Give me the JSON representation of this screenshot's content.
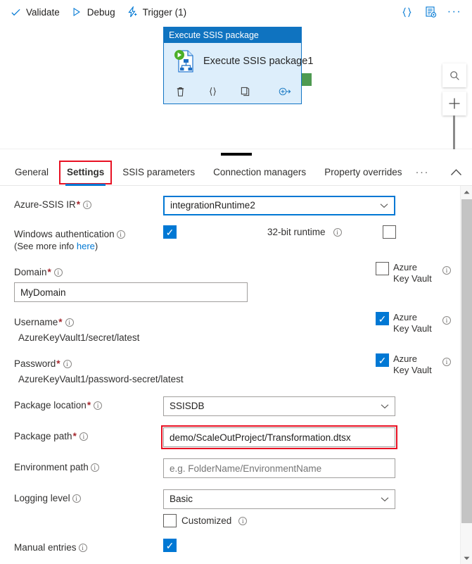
{
  "toolbar": {
    "validate_label": "Validate",
    "debug_label": "Debug",
    "trigger_label": "Trigger (1)",
    "code_icon_label": "{}",
    "dots_label": "···"
  },
  "canvas": {
    "activity": {
      "header": "Execute SSIS package",
      "title": "Execute SSIS package1"
    }
  },
  "tabs": {
    "items": [
      {
        "label": "General",
        "active": false,
        "marked": false
      },
      {
        "label": "Settings",
        "active": true,
        "marked": true
      },
      {
        "label": "SSIS parameters",
        "active": false,
        "marked": false
      },
      {
        "label": "Connection managers",
        "active": false,
        "marked": false
      },
      {
        "label": "Property overrides",
        "active": false,
        "marked": false
      }
    ],
    "overflow_label": "···"
  },
  "settings": {
    "azure_ssis_ir": {
      "label": "Azure-SSIS IR",
      "required": "*",
      "value": "integrationRuntime2"
    },
    "windows_auth": {
      "label": "Windows authentication",
      "sub_prefix": "(See more info ",
      "sub_link": "here",
      "sub_suffix": ")",
      "checked_mark": "✓"
    },
    "runtime_32bit": {
      "label": "32-bit runtime"
    },
    "domain": {
      "label": "Domain",
      "required": "*",
      "value": "MyDomain",
      "akv_label": "Azure Key Vault"
    },
    "username": {
      "label": "Username",
      "required": "*",
      "value": "AzureKeyVault1/secret/latest",
      "akv_label": "Azure Key Vault"
    },
    "password": {
      "label": "Password",
      "required": "*",
      "value": "AzureKeyVault1/password-secret/latest",
      "akv_label": "Azure Key Vault"
    },
    "package_location": {
      "label": "Package location",
      "required": "*",
      "value": "SSISDB"
    },
    "package_path": {
      "label": "Package path",
      "required": "*",
      "value": "demo/ScaleOutProject/Transformation.dtsx"
    },
    "environment_path": {
      "label": "Environment path",
      "placeholder": "e.g. FolderName/EnvironmentName",
      "value": ""
    },
    "logging_level": {
      "label": "Logging level",
      "value": "Basic",
      "customized_label": "Customized"
    },
    "manual_entries": {
      "label": "Manual entries"
    }
  },
  "colors": {
    "accent": "#0078d4",
    "activity_header": "#0f73c0",
    "activity_body": "#ddeefb",
    "highlight_red": "#e81123",
    "required_red": "#a4262c",
    "output_handle_green": "#4e9a51"
  }
}
